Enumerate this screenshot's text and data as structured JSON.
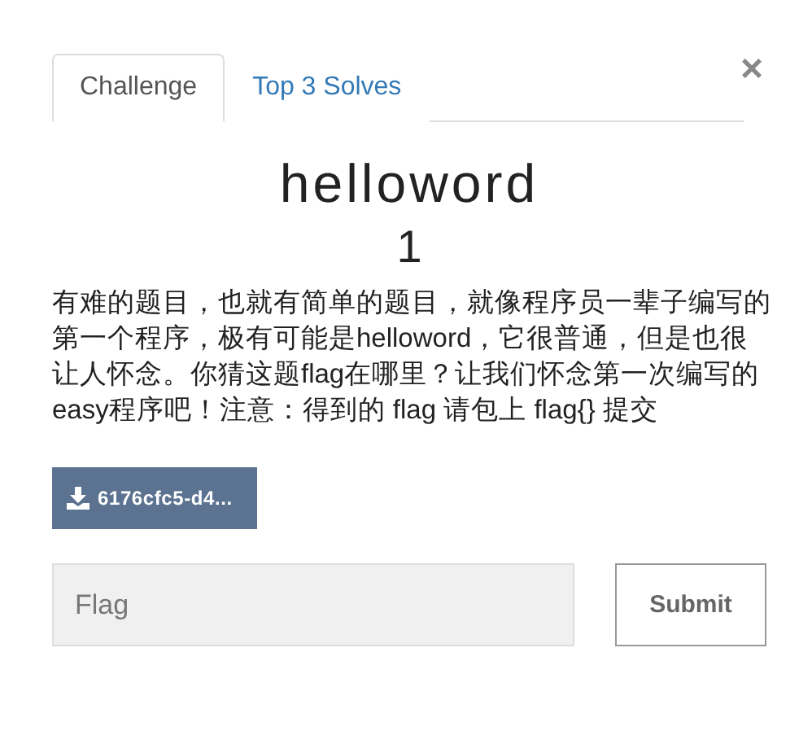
{
  "tabs": [
    {
      "label": "Challenge",
      "selected": true
    },
    {
      "label": "Top 3 Solves",
      "selected": false
    }
  ],
  "close": "×",
  "challenge": {
    "name": "helloword",
    "value": "1",
    "description": "有难的题目，也就有简单的题目，就像程序员一辈子编写的第一个程序，极有可能是helloword，它很普通，但是也很让人怀念。你猜这题flag在哪里？让我们怀念第一次编写的easy程序吧！注意：得到的 flag 请包上 flag{} 提交",
    "file": "6176cfc5-d4..."
  },
  "flag_field": {
    "placeholder": "Flag"
  },
  "submit": "Submit"
}
